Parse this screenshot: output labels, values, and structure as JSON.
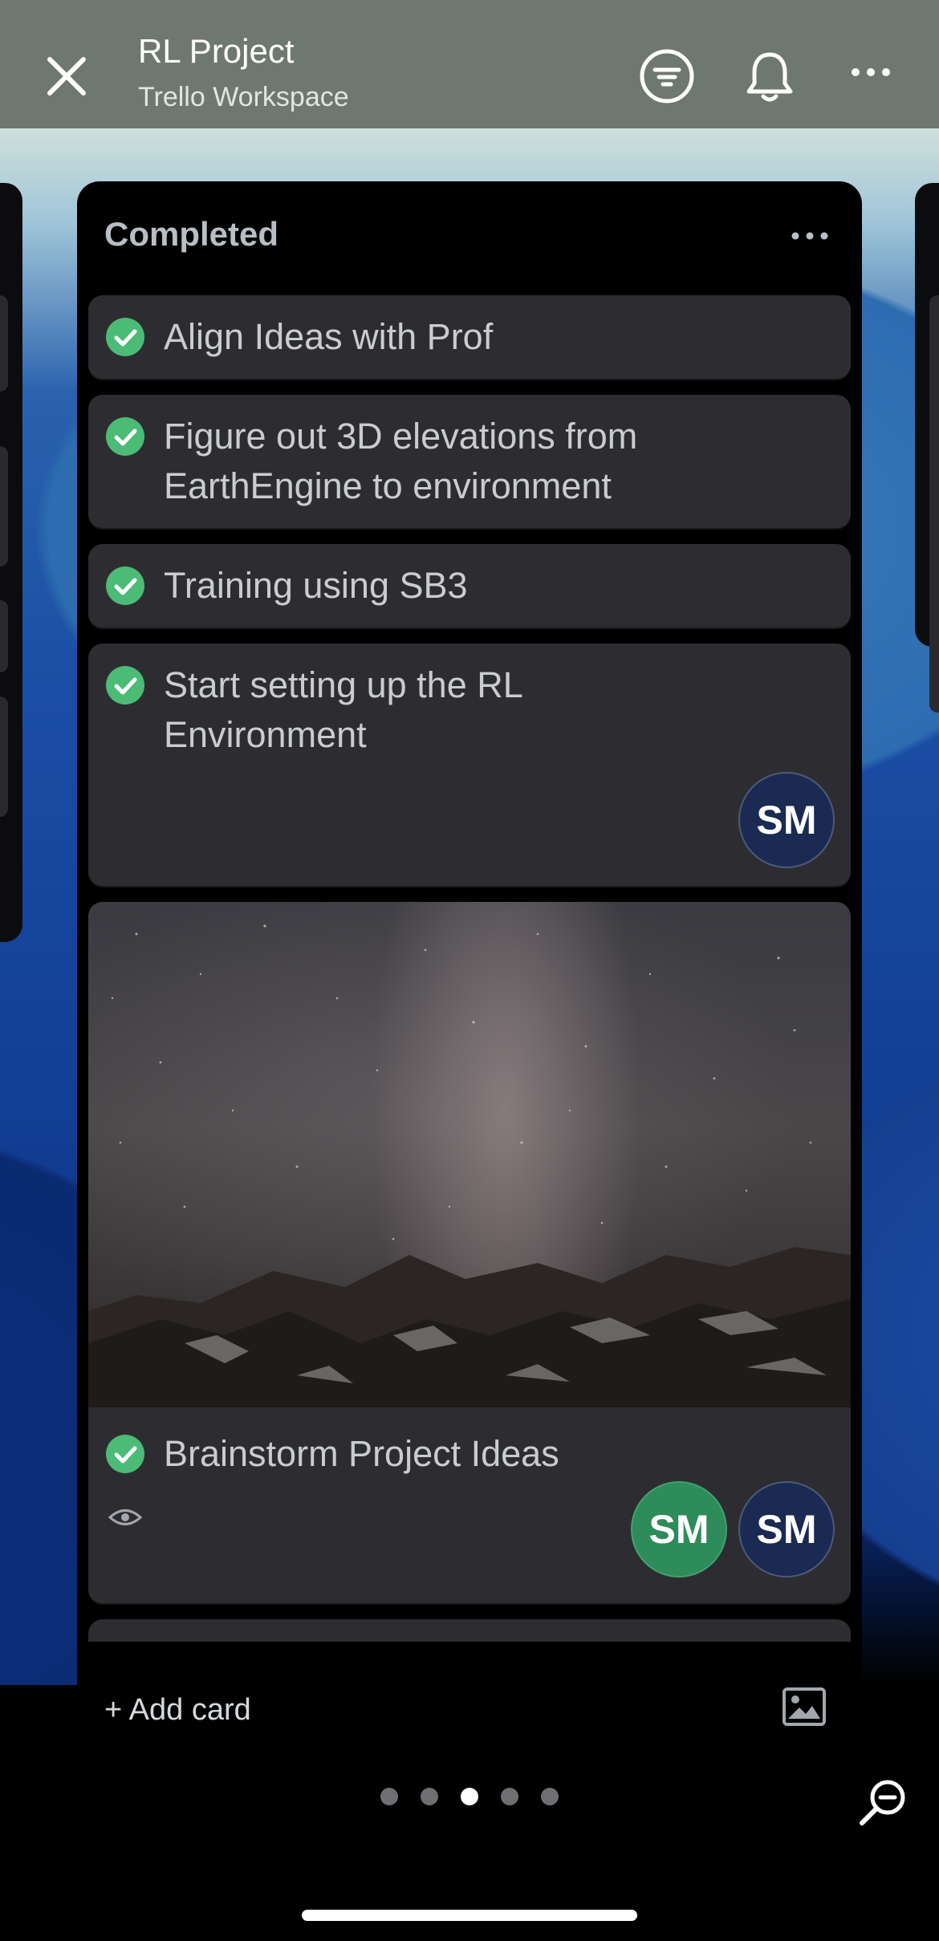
{
  "header": {
    "title": "RL Project",
    "workspace": "Trello Workspace",
    "icons": [
      "close-icon",
      "filter-icon",
      "bell-icon",
      "more-icon"
    ]
  },
  "list": {
    "title": "Completed",
    "cards": [
      {
        "title": "Align Ideas with Prof",
        "completed": true
      },
      {
        "title_line1": "Figure out 3D elevations from",
        "title_line2": "EarthEngine to environment",
        "completed": true
      },
      {
        "title": "Training using SB3",
        "completed": true
      },
      {
        "title_line1": "Start setting up the RL",
        "title_line2": "Environment",
        "completed": true,
        "members": [
          "SM"
        ]
      },
      {
        "title": "Brainstorm Project Ideas",
        "completed": true,
        "cover": "milky-way-over-mountains",
        "watching": true,
        "members": [
          "SM",
          "SM"
        ]
      }
    ],
    "footer": {
      "add_card": "+ Add card",
      "icon": "image-icon"
    }
  },
  "pagination": {
    "count": 5,
    "active_index": 2
  },
  "colors": {
    "topbar": "#6f7870",
    "card": "#2d2d31",
    "check": "#4cbb76",
    "avatar_navy": "#1b2a52",
    "avatar_green": "#2e8b5a"
  }
}
